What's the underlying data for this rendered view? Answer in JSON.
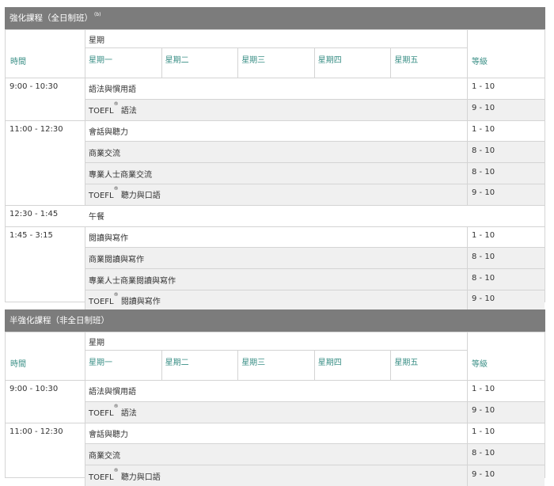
{
  "schedules": [
    {
      "title": "強化課程（全日制班）",
      "title_note": "(b)",
      "header": {
        "time_label": "時間",
        "week_label": "星期",
        "days": [
          "星期一",
          "星期二",
          "星期三",
          "星期四",
          "星期五"
        ],
        "level_label": "等級"
      },
      "rows": [
        {
          "time": "9:00 - 10:30",
          "course": "語法與慣用語",
          "level": "1 - 10"
        },
        {
          "time": "",
          "course_pre": "TOEFL",
          "reg": "®",
          "course": "語法",
          "level": "9 - 10"
        },
        {
          "time": "11:00 - 12:30",
          "course": "會話與聽力",
          "level": "1 - 10"
        },
        {
          "time": "",
          "course": "商業交流",
          "level": "8 - 10"
        },
        {
          "time": "",
          "course": "專業人士商業交流",
          "level": "8 - 10"
        },
        {
          "time": "",
          "course_pre": "TOEFL",
          "reg": "®",
          "course": "聽力與口語",
          "level": "9 - 10"
        },
        {
          "time": "12:30 - 1:45",
          "course": "午餐",
          "level": ""
        },
        {
          "time": "1:45 - 3:15",
          "course": "閱讀與寫作",
          "level": "1 - 10"
        },
        {
          "time": "",
          "course": "商業閱讀與寫作",
          "level": "8 - 10"
        },
        {
          "time": "",
          "course": "專業人士商業閱讀與寫作",
          "level": "8 - 10"
        },
        {
          "time": "",
          "course_pre": "TOEFL",
          "reg": "®",
          "course": "閱讀與寫作",
          "level": "9 - 10"
        }
      ]
    },
    {
      "title": "半強化課程（非全日制班）",
      "title_note": "",
      "header": {
        "time_label": "時間",
        "week_label": "星期",
        "days": [
          "星期一",
          "星期二",
          "星期三",
          "星期四",
          "星期五"
        ],
        "level_label": "等級"
      },
      "rows": [
        {
          "time": "9:00 - 10:30",
          "course": "語法與慣用語",
          "level": "1 - 10"
        },
        {
          "time": "",
          "course_pre": "TOEFL",
          "reg": "®",
          "course": "語法",
          "level": "9 - 10"
        },
        {
          "time": "11:00 - 12:30",
          "course": "會話與聽力",
          "level": "1 - 10"
        },
        {
          "time": "",
          "course": "商業交流",
          "level": "8 - 10"
        },
        {
          "time": "",
          "course_pre": "TOEFL",
          "reg": "®",
          "course": "聽力與口語",
          "level": "9 - 10"
        }
      ]
    }
  ]
}
